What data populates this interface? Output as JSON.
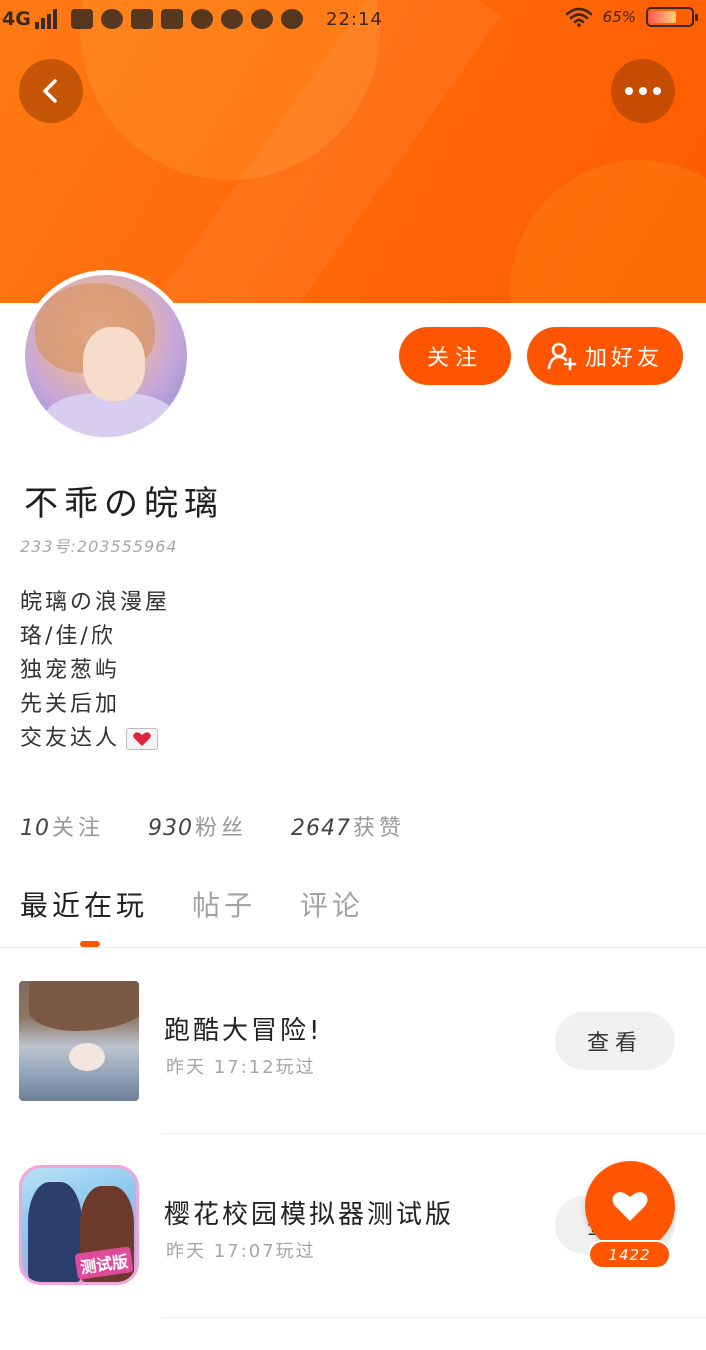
{
  "status_bar": {
    "network": "4G",
    "time": "22:14",
    "battery_pct": "65%",
    "battery_level": 0.65
  },
  "header": {
    "back_icon": "chevron-left-icon",
    "more_icon": "more-horizontal-icon",
    "accent_color": "#ff5500"
  },
  "profile": {
    "nickname": "不乖の皖璃",
    "uid": "233号:203555964",
    "bio": [
      "皖璃の浪漫屋",
      "珞/佳/欣",
      "独宠葱屿",
      "先关后加",
      "交友达人"
    ],
    "follow_label": "关注",
    "add_friend_label": "加好友"
  },
  "stats": [
    {
      "num": "10",
      "label": "关注"
    },
    {
      "num": "930",
      "label": "粉丝"
    },
    {
      "num": "2647",
      "label": "获赞"
    }
  ],
  "tabs": [
    "最近在玩",
    "帖子",
    "评论"
  ],
  "games": [
    {
      "title": "跑酷大冒险!",
      "time": "昨天 17:12玩过",
      "action": "查看"
    },
    {
      "title": "樱花校园模拟器测试版",
      "time": "昨天 17:07玩过",
      "action": "查看",
      "badge": "测试版"
    }
  ],
  "like": {
    "count": "1422",
    "icon": "heart-icon"
  }
}
